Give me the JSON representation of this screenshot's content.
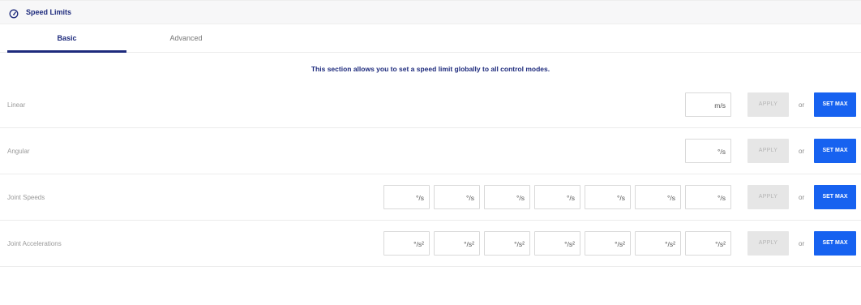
{
  "panel": {
    "title": "Speed Limits",
    "icon": "speedometer-icon"
  },
  "tabs": [
    {
      "label": "Basic",
      "active": true
    },
    {
      "label": "Advanced",
      "active": false
    }
  ],
  "intro": "This section allows you to set a speed limit globally to all control modes.",
  "rows": [
    {
      "label": "Linear",
      "units": [
        "m/s"
      ],
      "apply_label": "APPLY",
      "or_label": "or",
      "setmax_label": "SET MAX"
    },
    {
      "label": "Angular",
      "units": [
        "°/s"
      ],
      "apply_label": "APPLY",
      "or_label": "or",
      "setmax_label": "SET MAX"
    },
    {
      "label": "Joint Speeds",
      "units": [
        "°/s",
        "°/s",
        "°/s",
        "°/s",
        "°/s",
        "°/s",
        "°/s"
      ],
      "apply_label": "APPLY",
      "or_label": "or",
      "setmax_label": "SET MAX"
    },
    {
      "label": "Joint Accelerations",
      "units": [
        "°/s²",
        "°/s²",
        "°/s²",
        "°/s²",
        "°/s²",
        "°/s²",
        "°/s²"
      ],
      "apply_label": "APPLY",
      "or_label": "or",
      "setmax_label": "SET MAX"
    }
  ],
  "colors": {
    "accent": "#1D2A7C",
    "primary_button": "#1762F0",
    "disabled_button": "#E6E6E6"
  }
}
